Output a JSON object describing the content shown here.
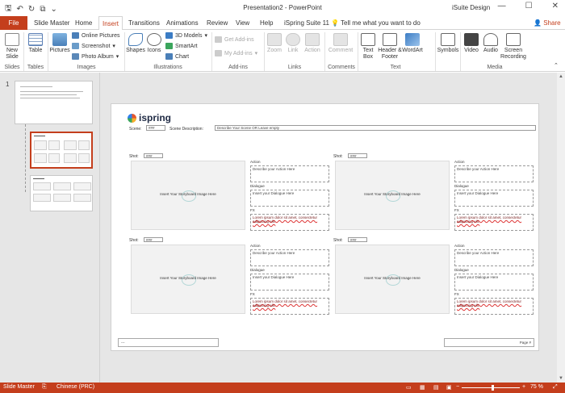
{
  "window": {
    "title": "Presentation2  -  PowerPoint",
    "account": "iSuite Design",
    "min_glyph": "—",
    "max_glyph": "☐",
    "close_glyph": "✕"
  },
  "qat": {
    "save_glyph": "🖫",
    "undo_glyph": "↶",
    "redo_glyph": "↻",
    "present_glyph": "⧉",
    "more_glyph": "⌄"
  },
  "tabs": [
    {
      "label": "File"
    },
    {
      "label": "Slide Master"
    },
    {
      "label": "Home"
    },
    {
      "label": "Insert"
    },
    {
      "label": "Transitions"
    },
    {
      "label": "Animations"
    },
    {
      "label": "Review"
    },
    {
      "label": "View"
    },
    {
      "label": "Help"
    },
    {
      "label": "iSpring Suite 11"
    }
  ],
  "tellme": "Tell me what you want to do",
  "share": "Share",
  "ribbon": {
    "new_slide": "New Slide",
    "table": "Table",
    "pictures": "Pictures",
    "online_pictures": "Online Pictures",
    "screenshot": "Screenshot",
    "photo_album": "Photo Album",
    "shapes": "Shapes",
    "icons": "Icons",
    "models_3d": "3D Models",
    "smartart": "SmartArt",
    "chart": "Chart",
    "get_addins": "Get Add-ins",
    "my_addins": "My Add-ins",
    "zoom": "Zoom",
    "link": "Link",
    "action": "Action",
    "comment": "Comment",
    "text_box": "Text Box",
    "header_footer": "Header & Footer",
    "wordart": "WordArt",
    "symbols": "Symbols",
    "video": "Video",
    "audio": "Audio",
    "screen_recording": "Screen Recording",
    "groups": {
      "slides": "Slides",
      "tables": "Tables",
      "images": "Images",
      "illustrations": "Illustrations",
      "addins": "Add-ins",
      "links": "Links",
      "comments": "Comments",
      "text": "Text",
      "media": "Media"
    }
  },
  "thumbs": {
    "slide_number": "1"
  },
  "slide": {
    "brand": "ispring",
    "scene_label": "Scene:",
    "scene_value": "###",
    "scene_desc_label": "Scene Description:",
    "scene_desc_value": "Describe Your Scene OR Leave empty",
    "panels": [
      {
        "shot_label": "Shot:",
        "shot_value": "###",
        "placeholder": "Insert Your Storyboard Image Here",
        "action_label": "Action",
        "action_value": "Describe your Action Here",
        "dialogue_label": "Dialogue",
        "dialogue_value": "Insert your Dialogue Here",
        "fx_label": "FX",
        "fx_value": "Lorem ipsum dolor sit amet, consectetur adipiscing elit."
      },
      {
        "shot_label": "Shot:",
        "shot_value": "###",
        "placeholder": "Insert Your Storyboard Image Here",
        "action_label": "Action",
        "action_value": "Describe your Action Here",
        "dialogue_label": "Dialogue",
        "dialogue_value": "Insert your Dialogue Here",
        "fx_label": "FX",
        "fx_value": "Lorem ipsum dolor sit amet, consectetur adipiscing elit."
      },
      {
        "shot_label": "Shot:",
        "shot_value": "###",
        "placeholder": "Insert Your Storyboard Image Here",
        "action_label": "Action",
        "action_value": "Describe your Action Here",
        "dialogue_label": "Dialogue",
        "dialogue_value": "Insert your Dialogue Here",
        "fx_label": "FX",
        "fx_value": "Lorem ipsum dolor sit amet, consectetur adipiscing elit."
      },
      {
        "shot_label": "Shot:",
        "shot_value": "###",
        "placeholder": "Insert Your Storyboard Image Here",
        "action_label": "Action",
        "action_value": "Describe your Action Here",
        "dialogue_label": "Dialogue",
        "dialogue_value": "Insert your Dialogue Here",
        "fx_label": "FX",
        "fx_value": "Lorem ipsum dolor sit amet, consectetur adipiscing elit."
      }
    ],
    "footer_left": "---",
    "footer_right": "Page #"
  },
  "status": {
    "view": "Slide Master",
    "language": "Chinese (PRC)",
    "zoom": "75 %",
    "zoom_minus": "−",
    "zoom_plus": "+"
  },
  "colors": {
    "accent": "#c43e1c"
  }
}
